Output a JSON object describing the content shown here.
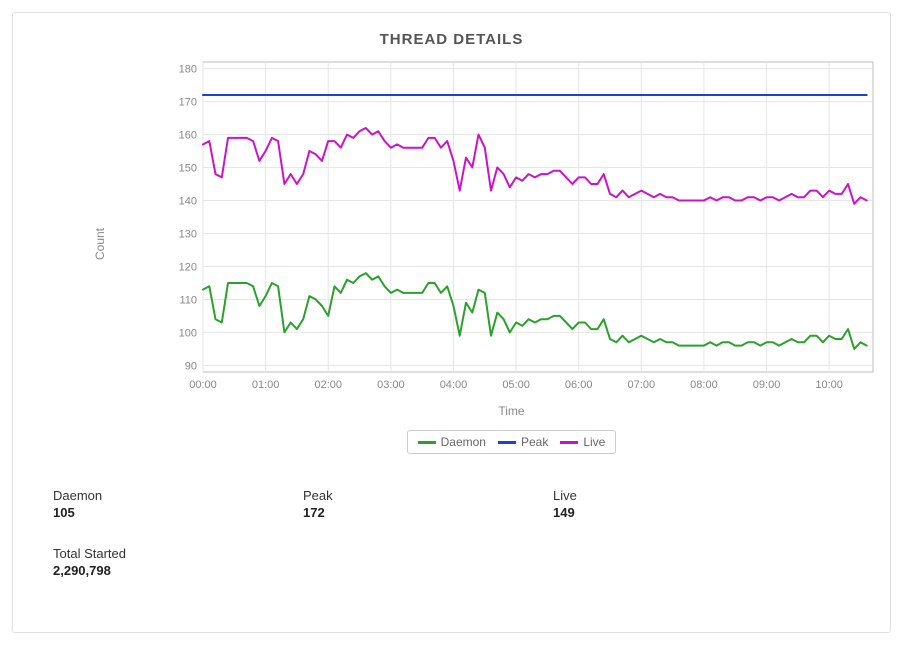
{
  "title": "THREAD DETAILS",
  "ylabel": "Count",
  "xlabel": "Time",
  "legend": {
    "daemon": "Daemon",
    "peak": "Peak",
    "live": "Live"
  },
  "colors": {
    "daemon": "#2ca02c",
    "peak": "#1f3fd6",
    "live": "#c814c8"
  },
  "stats": {
    "daemon_label": "Daemon",
    "daemon_value": "105",
    "peak_label": "Peak",
    "peak_value": "172",
    "live_label": "Live",
    "live_value": "149",
    "total_label": "Total Started",
    "total_value": "2,290,798"
  },
  "chart_data": {
    "type": "line",
    "xlabel": "Time",
    "ylabel": "Count",
    "title": "THREAD DETAILS",
    "x_ticks": [
      "00:00",
      "01:00",
      "02:00",
      "03:00",
      "04:00",
      "05:00",
      "06:00",
      "07:00",
      "08:00",
      "09:00",
      "10:00"
    ],
    "y_ticks": [
      90,
      100,
      110,
      120,
      130,
      140,
      150,
      160,
      170,
      180
    ],
    "xlim": [
      0,
      10.7
    ],
    "ylim": [
      88,
      182
    ],
    "series": [
      {
        "name": "Peak",
        "color": "#1f3fd6",
        "x": [
          0,
          0.1,
          0.2,
          0.3,
          0.4,
          0.5,
          0.6,
          0.7,
          0.8,
          0.9,
          1,
          1.1,
          1.2,
          1.3,
          1.4,
          1.5,
          1.6,
          1.7,
          1.8,
          1.9,
          2,
          2.1,
          2.2,
          2.3,
          2.4,
          2.5,
          2.6,
          2.7,
          2.8,
          2.9,
          3,
          3.1,
          3.2,
          3.3,
          3.4,
          3.5,
          3.6,
          3.7,
          3.8,
          3.9,
          4,
          4.1,
          4.2,
          4.3,
          4.4,
          4.5,
          4.6,
          4.7,
          4.8,
          4.9,
          5,
          5.1,
          5.2,
          5.3,
          5.4,
          5.5,
          5.6,
          5.7,
          5.8,
          5.9,
          6,
          6.1,
          6.2,
          6.3,
          6.4,
          6.5,
          6.6,
          6.7,
          6.8,
          6.9,
          7,
          7.1,
          7.2,
          7.3,
          7.4,
          7.5,
          7.6,
          7.7,
          7.8,
          7.9,
          8,
          8.1,
          8.2,
          8.3,
          8.4,
          8.5,
          8.6,
          8.7,
          8.8,
          8.9,
          9,
          9.1,
          9.2,
          9.3,
          9.4,
          9.5,
          9.6,
          9.7,
          9.8,
          9.9,
          10,
          10.1,
          10.2,
          10.3,
          10.4,
          10.5,
          10.6
        ],
        "y": [
          172,
          172,
          172,
          172,
          172,
          172,
          172,
          172,
          172,
          172,
          172,
          172,
          172,
          172,
          172,
          172,
          172,
          172,
          172,
          172,
          172,
          172,
          172,
          172,
          172,
          172,
          172,
          172,
          172,
          172,
          172,
          172,
          172,
          172,
          172,
          172,
          172,
          172,
          172,
          172,
          172,
          172,
          172,
          172,
          172,
          172,
          172,
          172,
          172,
          172,
          172,
          172,
          172,
          172,
          172,
          172,
          172,
          172,
          172,
          172,
          172,
          172,
          172,
          172,
          172,
          172,
          172,
          172,
          172,
          172,
          172,
          172,
          172,
          172,
          172,
          172,
          172,
          172,
          172,
          172,
          172,
          172,
          172,
          172,
          172,
          172,
          172,
          172,
          172,
          172,
          172,
          172,
          172,
          172,
          172,
          172,
          172,
          172,
          172,
          172,
          172,
          172,
          172,
          172,
          172,
          172,
          172
        ]
      },
      {
        "name": "Live",
        "color": "#c814c8",
        "x": [
          0,
          0.1,
          0.2,
          0.3,
          0.4,
          0.5,
          0.6,
          0.7,
          0.8,
          0.9,
          1,
          1.1,
          1.2,
          1.3,
          1.4,
          1.5,
          1.6,
          1.7,
          1.8,
          1.9,
          2,
          2.1,
          2.2,
          2.3,
          2.4,
          2.5,
          2.6,
          2.7,
          2.8,
          2.9,
          3,
          3.1,
          3.2,
          3.3,
          3.4,
          3.5,
          3.6,
          3.7,
          3.8,
          3.9,
          4,
          4.1,
          4.2,
          4.3,
          4.4,
          4.5,
          4.6,
          4.7,
          4.8,
          4.9,
          5,
          5.1,
          5.2,
          5.3,
          5.4,
          5.5,
          5.6,
          5.7,
          5.8,
          5.9,
          6,
          6.1,
          6.2,
          6.3,
          6.4,
          6.5,
          6.6,
          6.7,
          6.8,
          6.9,
          7,
          7.1,
          7.2,
          7.3,
          7.4,
          7.5,
          7.6,
          7.7,
          7.8,
          7.9,
          8,
          8.1,
          8.2,
          8.3,
          8.4,
          8.5,
          8.6,
          8.7,
          8.8,
          8.9,
          9,
          9.1,
          9.2,
          9.3,
          9.4,
          9.5,
          9.6,
          9.7,
          9.8,
          9.9,
          10,
          10.1,
          10.2,
          10.3,
          10.4,
          10.5,
          10.6
        ],
        "y": [
          157,
          158,
          148,
          147,
          159,
          159,
          159,
          159,
          158,
          152,
          155,
          159,
          158,
          145,
          148,
          145,
          148,
          155,
          154,
          152,
          158,
          158,
          156,
          160,
          159,
          161,
          162,
          160,
          161,
          158,
          156,
          157,
          156,
          156,
          156,
          156,
          159,
          159,
          156,
          158,
          152,
          143,
          153,
          150,
          160,
          156,
          143,
          150,
          148,
          144,
          147,
          146,
          148,
          147,
          148,
          148,
          149,
          149,
          147,
          145,
          147,
          147,
          145,
          145,
          148,
          142,
          141,
          143,
          141,
          142,
          143,
          142,
          141,
          142,
          141,
          141,
          140,
          140,
          140,
          140,
          140,
          141,
          140,
          141,
          141,
          140,
          140,
          141,
          141,
          140,
          141,
          141,
          140,
          141,
          142,
          141,
          141,
          143,
          143,
          141,
          143,
          142,
          142,
          145,
          139,
          141,
          140
        ]
      },
      {
        "name": "Daemon",
        "color": "#2ca02c",
        "x": [
          0,
          0.1,
          0.2,
          0.3,
          0.4,
          0.5,
          0.6,
          0.7,
          0.8,
          0.9,
          1,
          1.1,
          1.2,
          1.3,
          1.4,
          1.5,
          1.6,
          1.7,
          1.8,
          1.9,
          2,
          2.1,
          2.2,
          2.3,
          2.4,
          2.5,
          2.6,
          2.7,
          2.8,
          2.9,
          3,
          3.1,
          3.2,
          3.3,
          3.4,
          3.5,
          3.6,
          3.7,
          3.8,
          3.9,
          4,
          4.1,
          4.2,
          4.3,
          4.4,
          4.5,
          4.6,
          4.7,
          4.8,
          4.9,
          5,
          5.1,
          5.2,
          5.3,
          5.4,
          5.5,
          5.6,
          5.7,
          5.8,
          5.9,
          6,
          6.1,
          6.2,
          6.3,
          6.4,
          6.5,
          6.6,
          6.7,
          6.8,
          6.9,
          7,
          7.1,
          7.2,
          7.3,
          7.4,
          7.5,
          7.6,
          7.7,
          7.8,
          7.9,
          8,
          8.1,
          8.2,
          8.3,
          8.4,
          8.5,
          8.6,
          8.7,
          8.8,
          8.9,
          9,
          9.1,
          9.2,
          9.3,
          9.4,
          9.5,
          9.6,
          9.7,
          9.8,
          9.9,
          10,
          10.1,
          10.2,
          10.3,
          10.4,
          10.5,
          10.6
        ],
        "y": [
          113,
          114,
          104,
          103,
          115,
          115,
          115,
          115,
          114,
          108,
          111,
          115,
          114,
          100,
          103,
          101,
          104,
          111,
          110,
          108,
          105,
          114,
          112,
          116,
          115,
          117,
          118,
          116,
          117,
          114,
          112,
          113,
          112,
          112,
          112,
          112,
          115,
          115,
          112,
          114,
          108,
          99,
          109,
          106,
          113,
          112,
          99,
          106,
          104,
          100,
          103,
          102,
          104,
          103,
          104,
          104,
          105,
          105,
          103,
          101,
          103,
          103,
          101,
          101,
          104,
          98,
          97,
          99,
          97,
          98,
          99,
          98,
          97,
          98,
          97,
          97,
          96,
          96,
          96,
          96,
          96,
          97,
          96,
          97,
          97,
          96,
          96,
          97,
          97,
          96,
          97,
          97,
          96,
          97,
          98,
          97,
          97,
          99,
          99,
          97,
          99,
          98,
          98,
          101,
          95,
          97,
          96
        ]
      }
    ]
  }
}
